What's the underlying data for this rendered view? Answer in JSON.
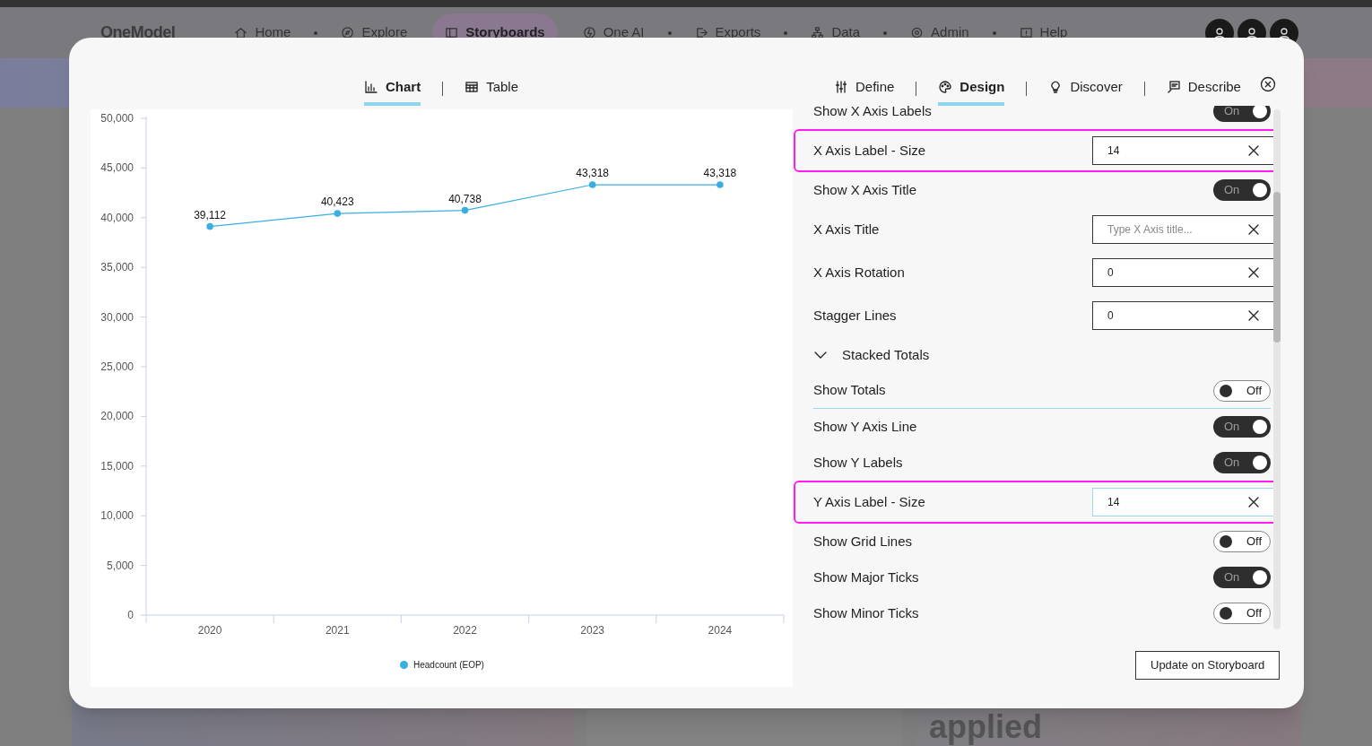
{
  "app": {
    "logo": "OneModel",
    "nav": [
      {
        "label": "Home",
        "selected": false
      },
      {
        "label": "Explore",
        "selected": false
      },
      {
        "label": "Storyboards",
        "selected": true
      },
      {
        "label": "One AI",
        "selected": false
      },
      {
        "label": "Exports",
        "selected": false
      },
      {
        "label": "Data",
        "selected": false
      },
      {
        "label": "Admin",
        "selected": false
      },
      {
        "label": "Help",
        "selected": false
      }
    ],
    "background_text": "applied"
  },
  "dialog": {
    "view_tabs": [
      {
        "label": "Chart",
        "selected": true
      },
      {
        "label": "Table",
        "selected": false
      }
    ],
    "settings_tabs": [
      {
        "label": "Define",
        "selected": false
      },
      {
        "label": "Design",
        "selected": true
      },
      {
        "label": "Discover",
        "selected": false
      },
      {
        "label": "Describe",
        "selected": false
      }
    ],
    "chart": {
      "chart_data": {
        "type": "line",
        "categories": [
          "2020",
          "2021",
          "2022",
          "2023",
          "2024"
        ],
        "series": [
          {
            "name": "Headcount (EOP)",
            "color": "#3aaee0",
            "marker": "circle",
            "values": [
              39112,
              40423,
              40738,
              43318,
              43318
            ]
          }
        ],
        "ylim": [
          0,
          50000
        ],
        "yticks": [
          {
            "value": 0,
            "label": "0"
          },
          {
            "value": 5000,
            "label": "5,000"
          },
          {
            "value": 10000,
            "label": "10,000"
          },
          {
            "value": 15000,
            "label": "15,000"
          },
          {
            "value": 20000,
            "label": "20,000"
          },
          {
            "value": 25000,
            "label": "25,000"
          },
          {
            "value": 30000,
            "label": "30,000"
          },
          {
            "value": 35000,
            "label": "35,000"
          },
          {
            "value": 40000,
            "label": "40,000"
          },
          {
            "value": 45000,
            "label": "45,000"
          },
          {
            "value": 50000,
            "label": "50,000"
          }
        ],
        "value_labels": [
          "39,112",
          "40,423",
          "40,738",
          "43,318",
          "43,318"
        ]
      }
    },
    "settings": [
      {
        "kind": "toggle",
        "label": "Show X Axis Labels",
        "on": true,
        "state_text": "On"
      },
      {
        "kind": "input",
        "label": "X Axis Label - Size",
        "value": "14",
        "highlighted": true,
        "focused": false
      },
      {
        "kind": "toggle",
        "label": "Show X Axis Title",
        "on": true,
        "state_text": "On"
      },
      {
        "kind": "input",
        "label": "X Axis Title",
        "placeholder": "Type X Axis title...",
        "highlighted": false,
        "focused": false
      },
      {
        "kind": "input",
        "label": "X Axis Rotation",
        "value": "0",
        "highlighted": false,
        "focused": false
      },
      {
        "kind": "input",
        "label": "Stagger Lines",
        "value": "0",
        "highlighted": false,
        "focused": false
      },
      {
        "kind": "section",
        "label": "Stacked Totals",
        "expanded": true
      },
      {
        "kind": "toggle",
        "label": "Show Totals",
        "on": false,
        "state_text": "Off",
        "divider": true
      },
      {
        "kind": "toggle",
        "label": "Show Y Axis Line",
        "on": true,
        "state_text": "On"
      },
      {
        "kind": "toggle",
        "label": "Show Y Labels",
        "on": true,
        "state_text": "On"
      },
      {
        "kind": "input",
        "label": "Y Axis Label - Size",
        "value": "14",
        "highlighted": true,
        "focused": true
      },
      {
        "kind": "toggle",
        "label": "Show Grid Lines",
        "on": false,
        "state_text": "Off"
      },
      {
        "kind": "toggle",
        "label": "Show Major Ticks",
        "on": true,
        "state_text": "On"
      },
      {
        "kind": "toggle",
        "label": "Show Minor Ticks",
        "on": false,
        "state_text": "Off"
      }
    ],
    "update_button": "Update on Storyboard"
  }
}
